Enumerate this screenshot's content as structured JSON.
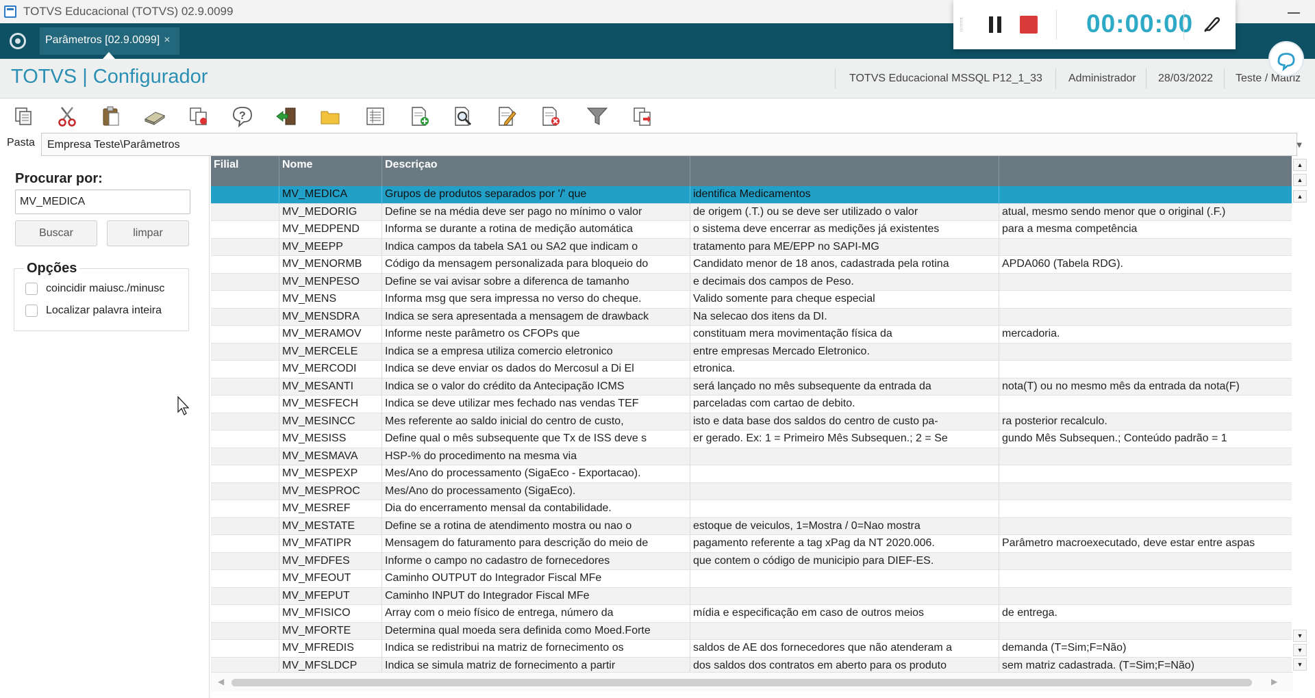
{
  "window": {
    "title": "TOTVS Educacional (TOTVS) 02.9.0099"
  },
  "tabs": [
    {
      "label": "Parâmetros [02.9.0099]",
      "close": "×"
    }
  ],
  "header": {
    "brand": "TOTVS | Configurador",
    "environment": "TOTVS Educacional MSSQL P12_1_33",
    "user": "Administrador",
    "date": "28/03/2022",
    "company": "Teste / Matriz"
  },
  "recorder": {
    "time": "00:00:00"
  },
  "toolbar": {
    "icons": [
      "copy-icon",
      "cut-icon",
      "paste-icon",
      "eraser-icon",
      "duplicate-icon",
      "help-icon",
      "exit-icon",
      "folder-icon",
      "list-icon",
      "add-document-icon",
      "search-document-icon",
      "edit-document-icon",
      "delete-document-icon",
      "filter-icon",
      "export-icon"
    ]
  },
  "pasta": {
    "label": "Pasta",
    "path": "Empresa Teste\\Parâmetros"
  },
  "search": {
    "title": "Procurar por:",
    "value": "MV_MEDICA",
    "search_button": "Buscar",
    "clear_button": "limpar",
    "options_title": "Opções",
    "options": [
      "coincidir maiusc./minusc",
      "Localizar palavra inteira"
    ]
  },
  "grid": {
    "columns": [
      "Filial",
      "Nome",
      "Descriçao",
      "",
      ""
    ],
    "selected_index": 0,
    "rows": [
      [
        "",
        "MV_MEDICA",
        "Grupos de produtos separados por '/' que",
        "identifica Medicamentos",
        ""
      ],
      [
        "",
        "MV_MEDORIG",
        "Define se na média deve ser pago no mínimo o valor",
        "de origem (.T.) ou se deve ser utilizado o valor",
        "atual, mesmo sendo menor que o original (.F.)"
      ],
      [
        "",
        "MV_MEDPEND",
        "Informa se durante a rotina de medição automática",
        "o sistema deve encerrar as medições já existentes",
        "para a mesma competência"
      ],
      [
        "",
        "MV_MEEPP",
        "Indica campos da tabela SA1 ou SA2 que indicam o",
        "tratamento para ME/EPP no SAPI-MG",
        ""
      ],
      [
        "",
        "MV_MENORMB",
        "Código da mensagem personalizada para bloqueio do",
        "Candidato menor de 18 anos, cadastrada pela rotina",
        "APDA060 (Tabela RDG)."
      ],
      [
        "",
        "MV_MENPESO",
        "Define se vai avisar sobre a diferenca de tamanho",
        "e decimais dos campos de Peso.",
        ""
      ],
      [
        "",
        "MV_MENS",
        "Informa msg que sera impressa no verso do cheque.",
        "Valido somente para cheque especial",
        ""
      ],
      [
        "",
        "MV_MENSDRA",
        "Indica se sera apresentada a mensagem de drawback",
        "Na selecao dos itens da DI.",
        ""
      ],
      [
        "",
        "MV_MERAMOV",
        "Informe neste parâmetro os CFOPs que",
        "constituam mera movimentação física da",
        "mercadoria."
      ],
      [
        "",
        "MV_MERCELE",
        "Indica se a empresa utiliza comercio eletronico",
        "entre empresas Mercado Eletronico.",
        ""
      ],
      [
        "",
        "MV_MERCODI",
        "Indica se deve enviar os dados do Mercosul a Di El",
        "etronica.",
        ""
      ],
      [
        "",
        "MV_MESANTI",
        "Indica se o valor do crédito da Antecipação ICMS",
        "será lançado no mês subsequente da entrada da",
        "nota(T) ou no mesmo mês da entrada da nota(F)"
      ],
      [
        "",
        "MV_MESFECH",
        "Indica se deve utilizar mes fechado nas vendas TEF",
        "parceladas com cartao de debito.",
        ""
      ],
      [
        "",
        "MV_MESINCC",
        "Mes referente ao saldo inicial do centro de custo,",
        "isto e data base dos saldos do centro de custo pa-",
        "ra posterior recalculo."
      ],
      [
        "",
        "MV_MESISS",
        "Define qual o mês subsequente que Tx de ISS deve s",
        "er gerado. Ex: 1 = Primeiro Mês Subsequen.; 2 = Se",
        "gundo Mês Subsequen.; Conteúdo padrão = 1"
      ],
      [
        "",
        "MV_MESMAVA",
        "HSP-% do procedimento na mesma via",
        "",
        ""
      ],
      [
        "",
        "MV_MESPEXP",
        "Mes/Ano do processamento (SigaEco - Exportacao).",
        "",
        ""
      ],
      [
        "",
        "MV_MESPROC",
        "Mes/Ano do processamento (SigaEco).",
        "",
        ""
      ],
      [
        "",
        "MV_MESREF",
        "Dia do encerramento mensal da contabilidade.",
        "",
        ""
      ],
      [
        "",
        "MV_MESTATE",
        "Define se a rotina de atendimento mostra ou nao o",
        "estoque de veiculos, 1=Mostra / 0=Nao mostra",
        ""
      ],
      [
        "",
        "MV_MFATIPR",
        "Mensagem do faturamento para descrição do meio de",
        "pagamento referente a tag xPag da NT 2020.006.",
        "Parâmetro macroexecutado, deve estar entre aspas"
      ],
      [
        "",
        "MV_MFDFES",
        "Informe o campo no cadastro de fornecedores",
        "que contem o código de municipio para DIEF-ES.",
        ""
      ],
      [
        "",
        "MV_MFEOUT",
        "Caminho OUTPUT do Integrador Fiscal MFe",
        "",
        ""
      ],
      [
        "",
        "MV_MFEPUT",
        "Caminho INPUT do Integrador Fiscal MFe",
        "",
        ""
      ],
      [
        "",
        "MV_MFISICO",
        "Array com o meio físico de entrega, número da",
        "mídia e especificação em caso de outros meios",
        "de entrega."
      ],
      [
        "",
        "MV_MFORTE",
        "Determina qual moeda sera definida como Moed.Forte",
        "",
        ""
      ],
      [
        "",
        "MV_MFREDIS",
        "Indica se redistribui na matriz de fornecimento os",
        "saldos de AE dos fornecedores que não atenderam a",
        "demanda (T=Sim;F=Não)"
      ],
      [
        "",
        "MV_MFSLDCP",
        "Indica se simula matriz de fornecimento a partir",
        "dos saldos dos contratos em aberto para os produto",
        "sem matriz cadastrada. (T=Sim;F=Não)"
      ]
    ]
  }
}
